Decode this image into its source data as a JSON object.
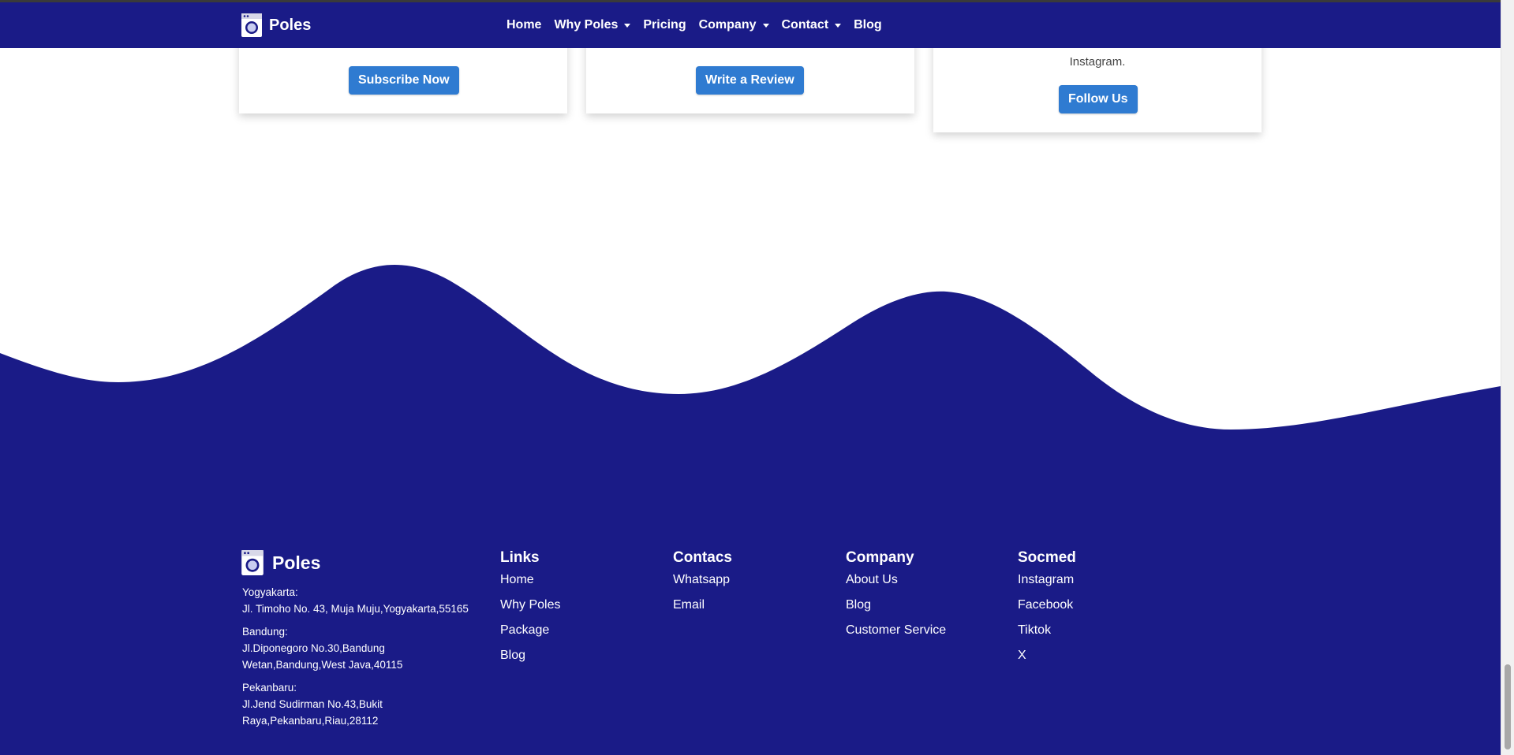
{
  "colors": {
    "navy": "#1a1b87",
    "button_blue": "#2f7bd1"
  },
  "nav": {
    "brand": "Poles",
    "items": [
      {
        "label": "Home",
        "dropdown": false
      },
      {
        "label": "Why Poles",
        "dropdown": true
      },
      {
        "label": "Pricing",
        "dropdown": false
      },
      {
        "label": "Company",
        "dropdown": true
      },
      {
        "label": "Contact",
        "dropdown": true
      },
      {
        "label": "Blog",
        "dropdown": false
      }
    ]
  },
  "cards": {
    "subscribe": {
      "button": "Subscribe Now"
    },
    "review": {
      "button": "Write a Review"
    },
    "follow": {
      "text": "Instagram.",
      "button": "Follow Us"
    }
  },
  "footer": {
    "brand": "Poles",
    "addresses": [
      {
        "city": "Yogyakarta:",
        "lines": [
          "Jl. Timoho No. 43, Muja Muju,Yogyakarta,55165"
        ]
      },
      {
        "city": "Bandung:",
        "lines": [
          "Jl.Diponegoro No.30,Bandung",
          "Wetan,Bandung,West Java,40115"
        ]
      },
      {
        "city": "Pekanbaru:",
        "lines": [
          "Jl.Jend Sudirman No.43,Bukit",
          "Raya,Pekanbaru,Riau,28112"
        ]
      }
    ],
    "columns": [
      {
        "title": "Links",
        "items": [
          "Home",
          "Why Poles",
          "Package",
          "Blog"
        ]
      },
      {
        "title": "Contacs",
        "items": [
          "Whatsapp",
          "Email"
        ]
      },
      {
        "title": "Company",
        "items": [
          "About Us",
          "Blog",
          "Customer Service"
        ]
      },
      {
        "title": "Socmed",
        "items": [
          "Instagram",
          "Facebook",
          "Tiktok",
          "X"
        ]
      }
    ]
  }
}
